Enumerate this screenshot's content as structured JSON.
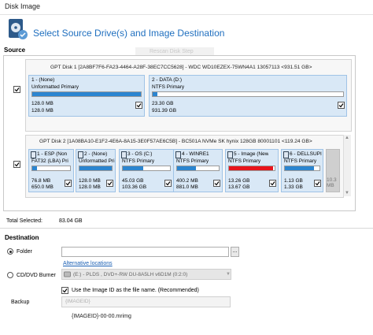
{
  "window": {
    "title": "Disk Image"
  },
  "header": {
    "title": "Select Source Drive(s) and Image Destination",
    "ghost_text": "Rescan Disk Step"
  },
  "source": {
    "label": "Source",
    "disk1": {
      "info": "GPT Disk 1 [2A8BF7F6-FA23-4464-A28F-38EC7CC5628] - WDC WD10EZEX-75WN4A1 13057113   <931.51 GB>",
      "checked": true,
      "partitions": [
        {
          "name": "1 - (None)",
          "type": "Unformatted Primary",
          "used": "128.0 MB",
          "total": "128.0 MB",
          "fill": 1.0,
          "checked": true
        },
        {
          "name": "2 - DATA (D:)",
          "type": "NTFS Primary",
          "used": "23.30 GB",
          "total": "931.39 GB",
          "fill": 0.025,
          "checked": true
        }
      ]
    },
    "disk2": {
      "info": "GPT Disk 2 [1A08BA10-E1F2-4E6A-8A15-3E0F57AE6C5B] - BC501A NVMe SK hynix 128GB 80001101   <119.24 GB>",
      "checked": true,
      "partitions": [
        {
          "name": "1 - ESP (Non",
          "type": "FAT32 (LBA) Pri",
          "used": "76.8 MB",
          "total": "650.0 MB",
          "fill": 0.12,
          "checked": true
        },
        {
          "name": "2 - (None)",
          "type": "Unformatted Pri",
          "used": "128.0 MB",
          "total": "128.0 MB",
          "fill": 1.0,
          "checked": true
        },
        {
          "name": "3 - OS (C:)",
          "type": "NTFS Primary",
          "used": "45.03 GB",
          "total": "103.36 GB",
          "fill": 0.44,
          "checked": true
        },
        {
          "name": "4 - WINRE1",
          "type": "NTFS Primary",
          "used": "400.2 MB",
          "total": "881.0 MB",
          "fill": 0.45,
          "checked": true
        },
        {
          "name": "5 - Image (New",
          "type": "NTFS Primary",
          "used": "13.26 GB",
          "total": "13.67 GB",
          "fill": 0.97,
          "fill_color": "#e8141b",
          "checked": true
        },
        {
          "name": "6 - DELLSUPI",
          "type": "NTFS Primary",
          "used": "1.13 GB",
          "total": "1.33 GB",
          "fill": 0.85,
          "checked": true
        }
      ],
      "unallocated": "10.3 MB"
    },
    "total_selected_label": "Total Selected:",
    "total_selected_value": "83.04 GB"
  },
  "destination": {
    "label": "Destination",
    "folder": {
      "label": "Folder",
      "selected": true,
      "value": "",
      "browse": "..."
    },
    "alt_link": "Alternative locations",
    "cd": {
      "label": "CD/DVD Burner",
      "selected": false,
      "drive": "(E:) - PLDS   , DVD+-RW DU-8A5LH v6D1M (0:2:0)"
    },
    "use_image_id": {
      "label": "Use the Image ID as the file name.  (Recommended)",
      "checked": true
    },
    "backup": {
      "label": "Backup",
      "value": "{IMAGEID}"
    },
    "filename_preview": "{IMAGEID}-00-00.mrimg"
  },
  "colors": {
    "accent": "#1f6fbf",
    "partition_bg": "#d9e8f6",
    "bar_fill": "#2b85d0",
    "bar_red": "#e8141b"
  }
}
